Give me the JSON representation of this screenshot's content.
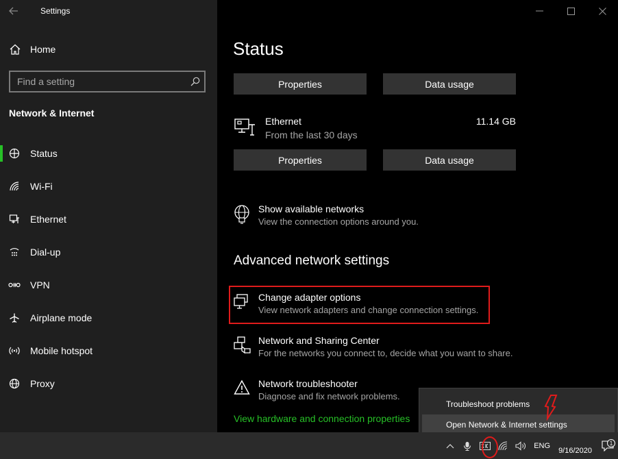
{
  "window": {
    "title": "Settings"
  },
  "sidebar": {
    "home_label": "Home",
    "search_placeholder": "Find a setting",
    "section_title": "Network & Internet",
    "items": [
      {
        "label": "Status",
        "icon": "status-icon",
        "active": true
      },
      {
        "label": "Wi-Fi",
        "icon": "wifi-icon"
      },
      {
        "label": "Ethernet",
        "icon": "ethernet-icon"
      },
      {
        "label": "Dial-up",
        "icon": "dialup-icon"
      },
      {
        "label": "VPN",
        "icon": "vpn-icon"
      },
      {
        "label": "Airplane mode",
        "icon": "airplane-icon"
      },
      {
        "label": "Mobile hotspot",
        "icon": "hotspot-icon"
      },
      {
        "label": "Proxy",
        "icon": "globe-icon"
      }
    ]
  },
  "main": {
    "title": "Status",
    "properties_label": "Properties",
    "data_usage_label": "Data usage",
    "ethernet": {
      "name": "Ethernet",
      "period": "From the last 30 days",
      "usage": "11.14 GB"
    },
    "show_networks": {
      "title": "Show available networks",
      "desc": "View the connection options around you."
    },
    "advanced_title": "Advanced network settings",
    "adapter": {
      "title": "Change adapter options",
      "desc": "View network adapters and change connection settings."
    },
    "sharing": {
      "title": "Network and Sharing Center",
      "desc": "For the networks you connect to, decide what you want to share."
    },
    "troubleshooter": {
      "title": "Network troubleshooter",
      "desc": "Diagnose and fix network problems."
    },
    "hardware_link": "View hardware and connection properties"
  },
  "context_menu": {
    "items": [
      "Troubleshoot problems",
      "Open Network & Internet settings"
    ]
  },
  "taskbar": {
    "language": "ENG",
    "date": "9/16/2020",
    "notification_count": "1"
  },
  "colors": {
    "accent_green": "#27c027",
    "highlight_red": "#e01b1b",
    "sidebar_bg": "#1f1f1f",
    "button_bg": "#333333"
  }
}
